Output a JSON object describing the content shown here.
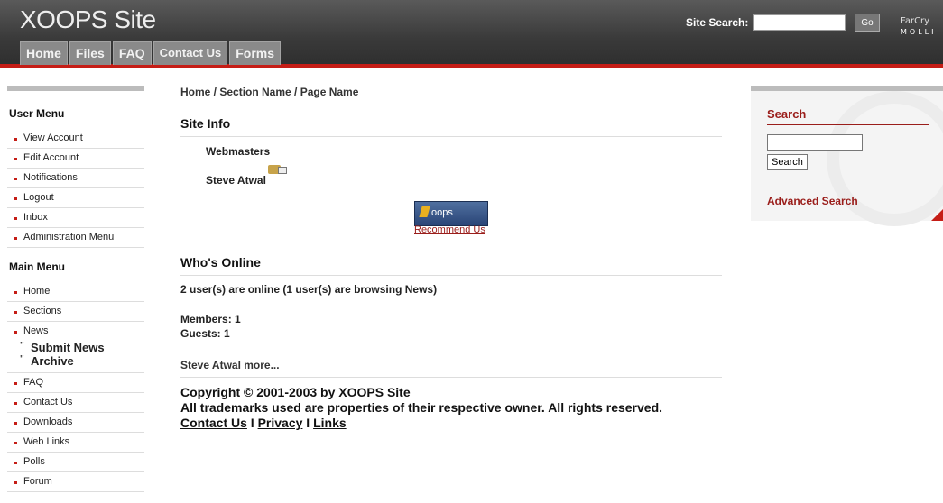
{
  "header": {
    "title": "XOOPS Site",
    "tabs": [
      "Home",
      "Files",
      "FAQ",
      "Contact Us",
      "Forms"
    ],
    "search_label": "Site Search:",
    "go_label": "Go",
    "brand_line1": "FarCry",
    "brand_line2": "MOLLI"
  },
  "sidebar": {
    "user_menu_title": "User Menu",
    "user_menu": [
      "View Account",
      "Edit Account",
      "Notifications",
      "Logout",
      "Inbox",
      "Administration Menu"
    ],
    "main_menu_title": "Main Menu",
    "main_menu": [
      "Home",
      "Sections",
      "News"
    ],
    "news_sub": [
      "Submit News",
      "Archive"
    ],
    "main_menu_after": [
      "FAQ",
      "Contact Us",
      "Downloads",
      "Web Links",
      "Polls",
      "Forum"
    ]
  },
  "main": {
    "breadcrumb": "Home / Section Name / Page Name",
    "site_info_title": "Site Info",
    "webmasters_label": "Webmasters",
    "webmaster_name": "Steve Atwal",
    "badge_text": "oops",
    "recommend_link": "Recommend Us",
    "whos_online_title": "Who's Online",
    "online_status": "2 user(s) are online (1 user(s) are browsing News)",
    "members": "Members: 1",
    "guests": "Guests: 1",
    "more_line": "Steve Atwal more...",
    "copyright": "Copyright © 2001-2003 by XOOPS Site",
    "trademarks": "All trademarks used are properties of their respective owner. All rights reserved.",
    "footer_links": [
      "Contact Us",
      "Privacy",
      "Links"
    ],
    "footer_sep": "I"
  },
  "right_panel": {
    "search_title": "Search",
    "search_button": "Search",
    "advanced_link": "Advanced Search"
  },
  "colors": {
    "accent_red": "#c51d16",
    "header_gray": "#3a3a3a",
    "link_red": "#9a1d1a"
  }
}
